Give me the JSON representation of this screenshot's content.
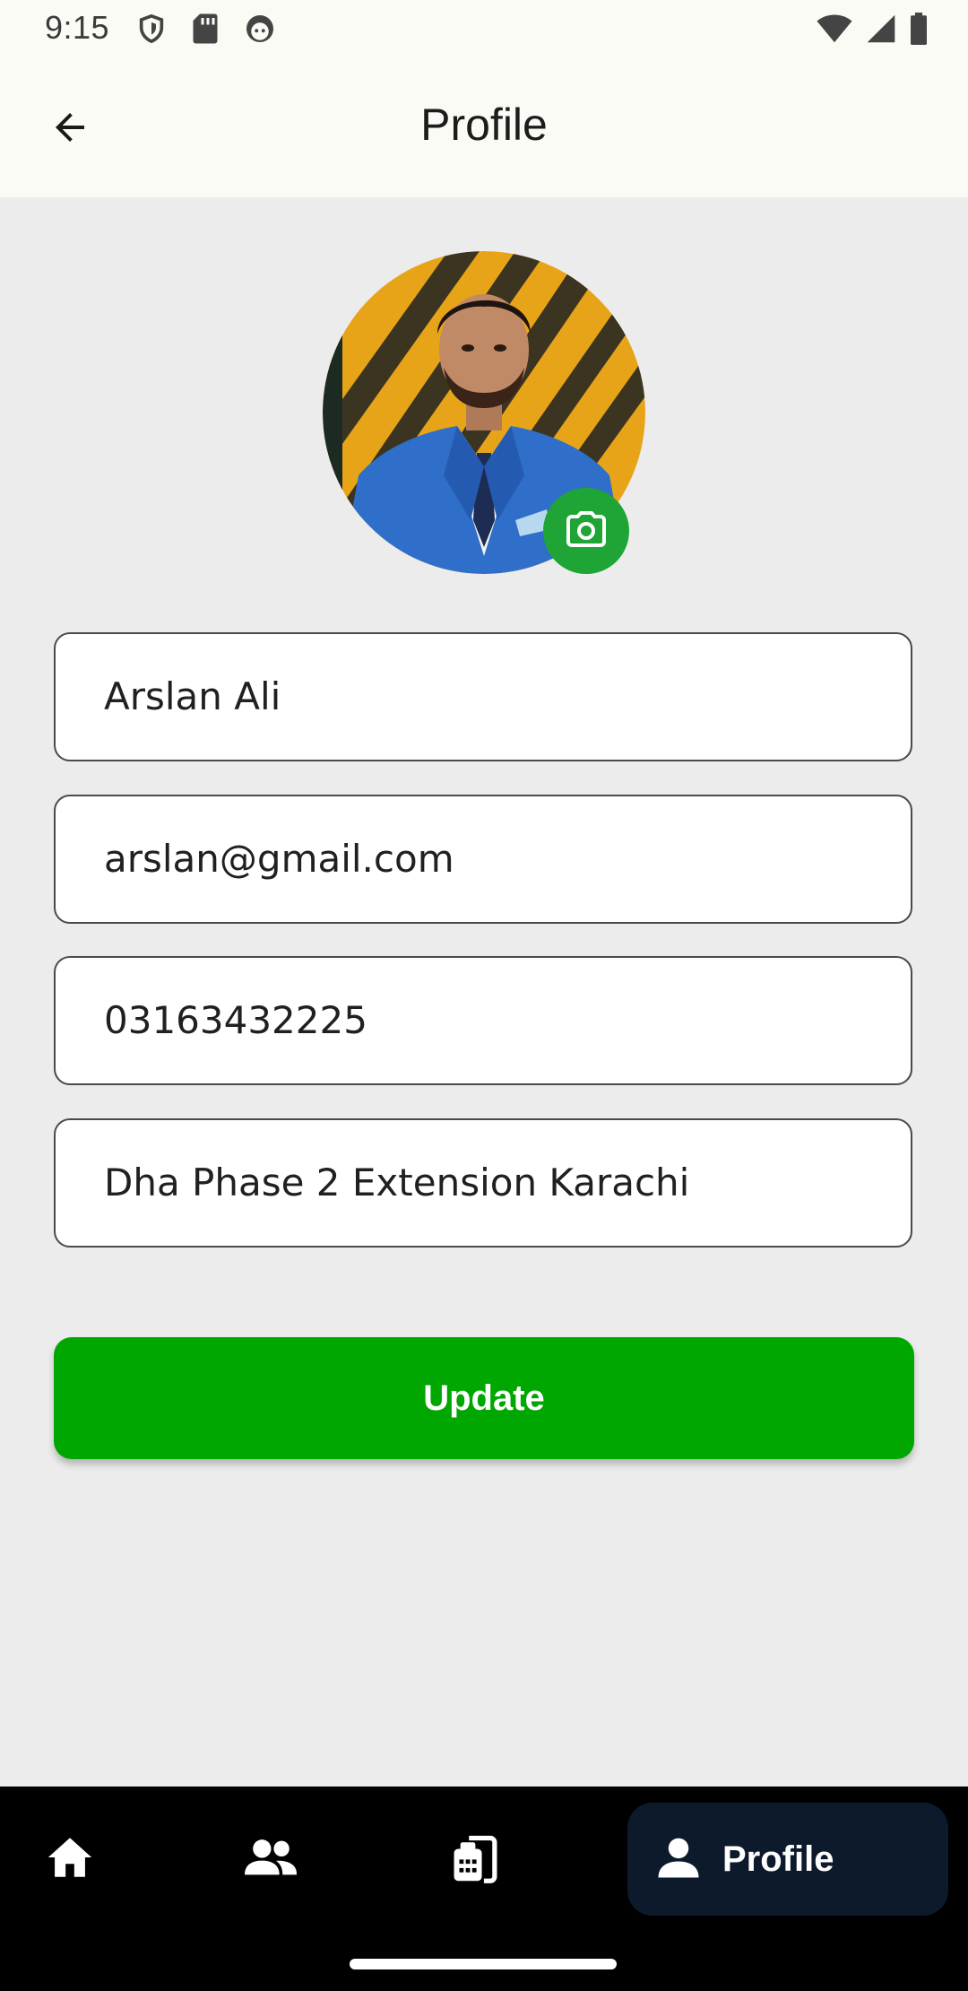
{
  "status_bar": {
    "time": "9:15",
    "icons": [
      "shield-icon",
      "sd-card-icon",
      "face-icon",
      "wifi-icon",
      "cell-signal-icon",
      "battery-icon"
    ]
  },
  "header": {
    "title": "Profile",
    "back_icon": "arrow-back-icon"
  },
  "profile": {
    "avatar": "user-avatar-photo",
    "camera_icon": "camera-icon",
    "camera_color": "#1fa535"
  },
  "form": {
    "name": "Arslan Ali",
    "email": "arslan@gmail.com",
    "phone": "03163432225",
    "address": "Dha Phase 2 Extension Karachi"
  },
  "update_button": {
    "label": "Update",
    "color": "#00a700"
  },
  "bottom_nav": {
    "items": [
      {
        "icon": "home-icon"
      },
      {
        "icon": "people-icon"
      },
      {
        "icon": "orders-icon"
      },
      {
        "icon": "person-icon",
        "label": "Profile",
        "selected": true
      }
    ],
    "selected_color": "#0c1a2b"
  }
}
